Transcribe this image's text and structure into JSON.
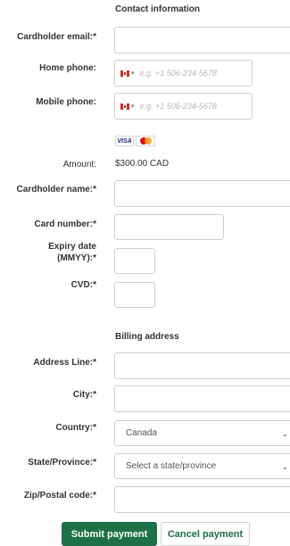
{
  "sections": {
    "contact_title": "Contact information",
    "billing_title": "Billing address"
  },
  "contact": {
    "email_label": "Cardholder email:*",
    "email_value": "",
    "home_phone_label": "Home phone:",
    "home_phone_placeholder": "e.g. +1 506-234-5678",
    "mobile_phone_label": "Mobile phone:",
    "mobile_phone_placeholder": "e.g. +1 506-234-5678",
    "phone_country_icon": "canada-flag-icon"
  },
  "payment": {
    "card_brands": [
      "visa",
      "mastercard"
    ],
    "visa_text": "VISA",
    "amount_label": "Amount:",
    "amount_value": "$300.00 CAD",
    "cardholder_name_label": "Cardholder name:*",
    "card_number_label": "Card number:*",
    "expiry_label_line1": "Expiry date",
    "expiry_label_line2": "(MMYY):*",
    "cvd_label": "CVD:*"
  },
  "billing": {
    "address_label": "Address Line:*",
    "city_label": "City:*",
    "country_label": "Country:*",
    "country_value": "Canada",
    "state_label": "State/Province:*",
    "state_placeholder": "Select a state/province",
    "zip_label": "Zip/Postal code:*"
  },
  "actions": {
    "submit_label": "Submit payment",
    "cancel_label": "Cancel payment"
  },
  "colors": {
    "primary": "#1d7048",
    "border": "#cfcfcf",
    "placeholder": "#b5b5b5"
  }
}
